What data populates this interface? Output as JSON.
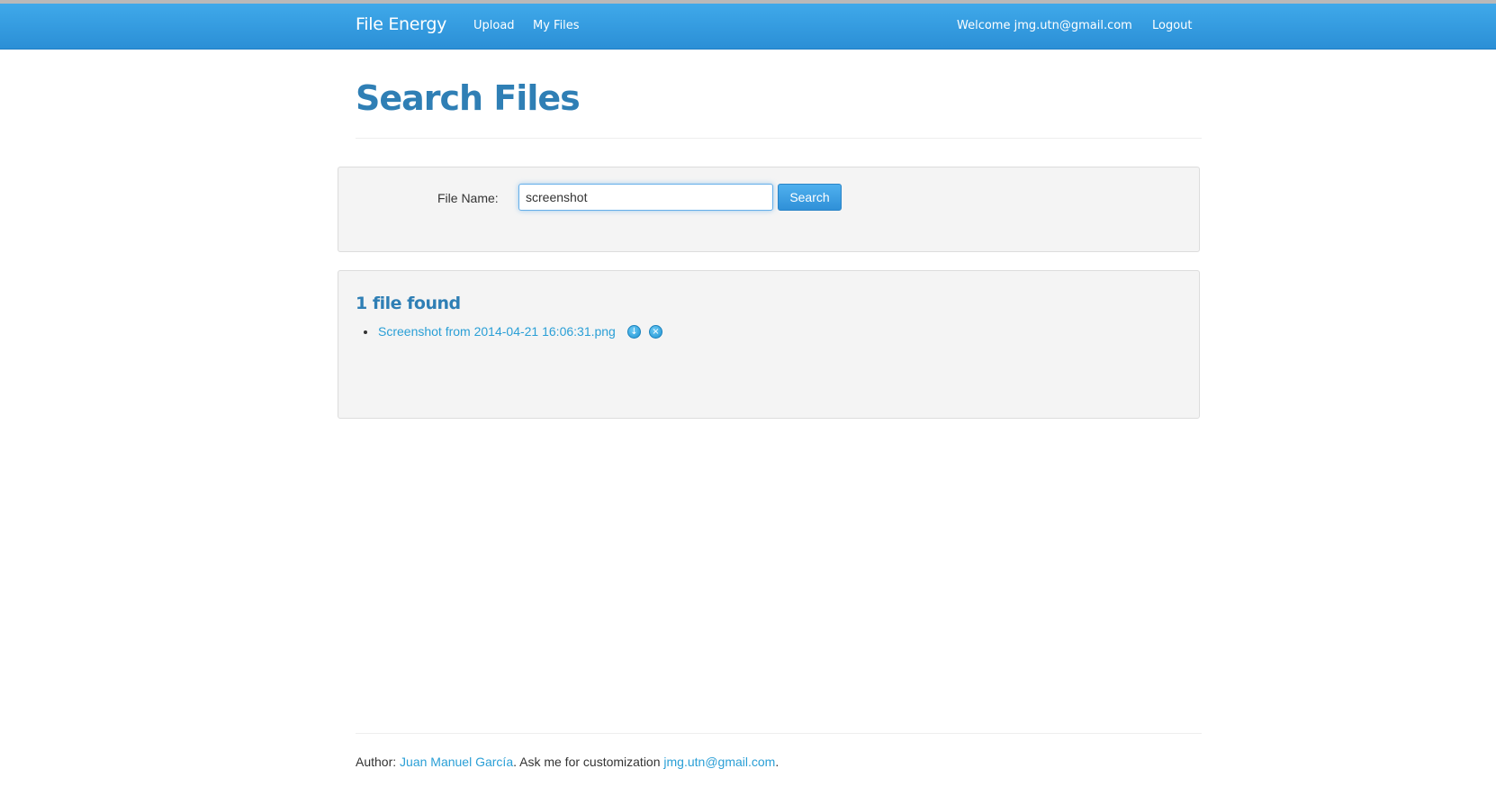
{
  "navbar": {
    "brand": "File Energy",
    "links": [
      {
        "label": "Upload"
      },
      {
        "label": "My Files"
      }
    ],
    "welcome": "Welcome jmg.utn@gmail.com",
    "logout": "Logout"
  },
  "page": {
    "title": "Search Files"
  },
  "search": {
    "label": "File Name:",
    "value": "screenshot",
    "button_label": "Search"
  },
  "results": {
    "heading": "1 file found",
    "files": [
      {
        "name": "Screenshot from 2014-04-21 16:06:31.png",
        "download_icon": "download-icon",
        "delete_icon": "delete-icon"
      }
    ]
  },
  "footer": {
    "prefix": "Author: ",
    "author": "Juan Manuel García",
    "middle": ". Ask me for customization ",
    "email": "jmg.utn@gmail.com",
    "suffix": "."
  },
  "colors": {
    "navbar": "#3fa9ea",
    "heading": "#2f7fb5",
    "link": "#2a9fd6",
    "well_background": "#f4f4f4"
  }
}
